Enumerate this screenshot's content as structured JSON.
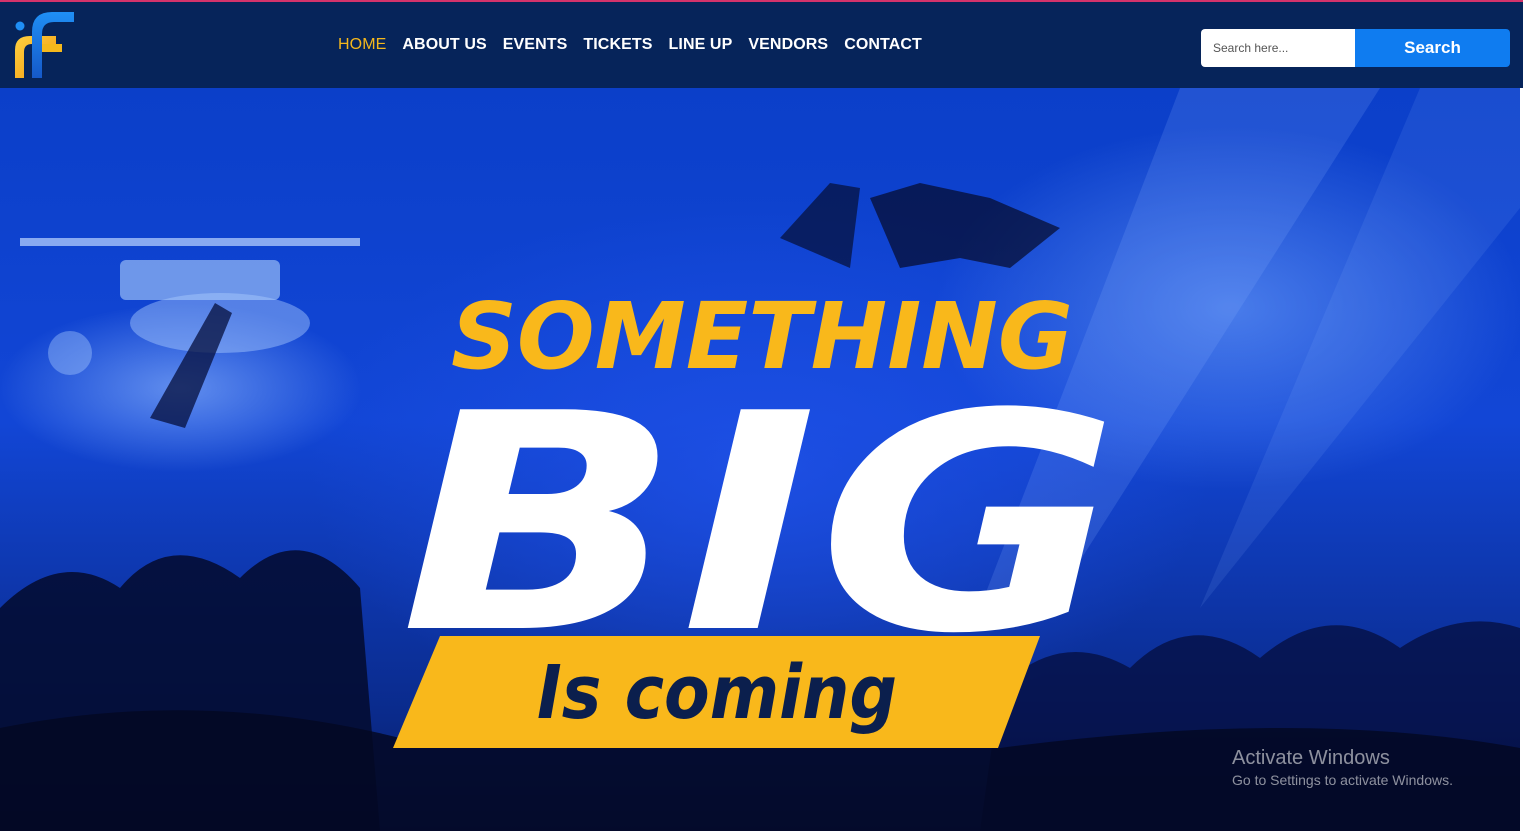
{
  "brand": {
    "logo_name": "festival-logo",
    "colors": {
      "navy": "#06245a",
      "gold": "#f5b81c",
      "blue": "#0f7cf0"
    }
  },
  "nav": {
    "items": [
      {
        "label": "HOME",
        "active": true
      },
      {
        "label": "ABOUT US"
      },
      {
        "label": "EVENTS"
      },
      {
        "label": "TICKETS"
      },
      {
        "label": "LINE UP"
      },
      {
        "label": "VENDORS"
      },
      {
        "label": "CONTACT"
      }
    ]
  },
  "search": {
    "placeholder": "Search here...",
    "button_label": "Search"
  },
  "hero": {
    "line1": "SOMETHING",
    "line2": "BIG",
    "line3": "Is coming"
  },
  "watermark": {
    "title": "Activate Windows",
    "subtitle": "Go to Settings to activate Windows."
  }
}
